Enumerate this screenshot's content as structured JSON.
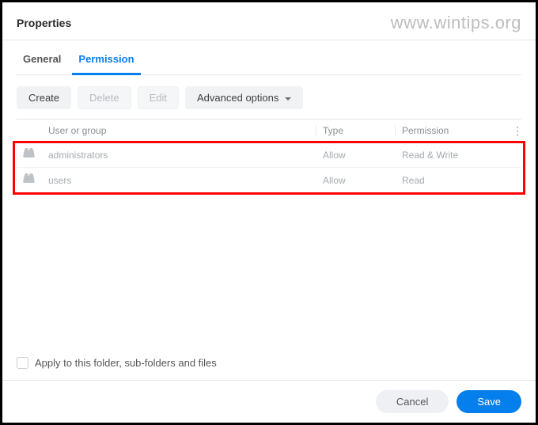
{
  "window": {
    "title": "Properties"
  },
  "watermark": "www.wintips.org",
  "tabs": {
    "general": "General",
    "permission": "Permission",
    "active": "permission"
  },
  "toolbar": {
    "create": "Create",
    "delete": "Delete",
    "edit": "Edit",
    "advanced": "Advanced options"
  },
  "table": {
    "headers": {
      "user_or_group": "User or group",
      "type": "Type",
      "permission": "Permission"
    },
    "rows": [
      {
        "name": "administrators",
        "type": "Allow",
        "permission": "Read & Write"
      },
      {
        "name": "users",
        "type": "Allow",
        "permission": "Read"
      }
    ]
  },
  "apply_label": "Apply to this folder, sub-folders and files",
  "footer": {
    "cancel": "Cancel",
    "save": "Save"
  }
}
